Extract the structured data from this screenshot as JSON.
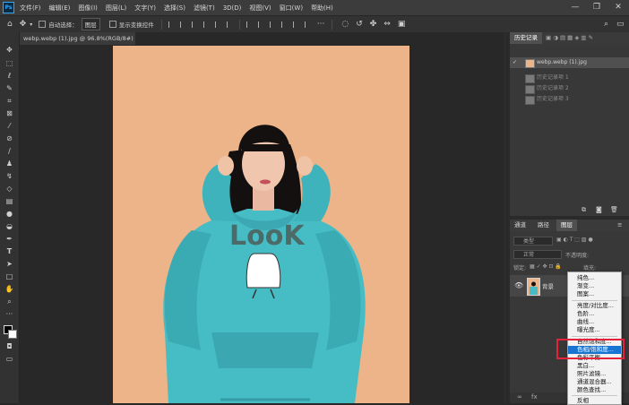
{
  "app": {
    "logo": "Ps"
  },
  "menubar": {
    "items": [
      "文件(F)",
      "编辑(E)",
      "图像(I)",
      "图层(L)",
      "文字(Y)",
      "选择(S)",
      "滤镜(T)",
      "3D(D)",
      "视图(V)",
      "窗口(W)",
      "帮助(H)"
    ],
    "window_buttons": [
      "minimize-icon",
      "restore-icon",
      "close-icon"
    ]
  },
  "options_bar": {
    "auto_select_label": "自动选择：",
    "auto_select_value": "图层",
    "show_transform_label": "显示变换控件",
    "more": "···"
  },
  "document": {
    "tab_title": "webp.webp (1).jpg @ 96.8%(RGB/8#) *",
    "tab_close": "×"
  },
  "history_panel": {
    "title": "历史记录",
    "snapshot": "webp.webp (1).jpg",
    "items": [
      "历史记录项 1",
      "历史记录项 2",
      "历史记录项 3"
    ]
  },
  "layers_panel": {
    "tabs": [
      "通道",
      "路径",
      "图层"
    ],
    "active_tab": "图层",
    "search_placeholder": "类型",
    "blend_mode": "正常",
    "opacity_label": "不透明度:",
    "lock_label": "锁定:",
    "fill_label": "填充:",
    "layer_name": "背景"
  },
  "adjustment_menu": {
    "groups": [
      [
        "纯色...",
        "渐变...",
        "图案..."
      ],
      [
        "亮度/对比度...",
        "色阶...",
        "曲线...",
        "曝光度..."
      ],
      [
        "自然饱和度...",
        "色相/饱和度...",
        "色彩平衡...",
        "黑白...",
        "照片滤镜...",
        "通道混合器...",
        "颜色查找..."
      ],
      [
        "反相"
      ]
    ],
    "highlighted": "色相/饱和度..."
  },
  "colors": {
    "accent": "#1874d2",
    "highlight_box": "#e4233a",
    "canvas_bg": "#ecb488",
    "hoodie": "#46bcc4"
  }
}
